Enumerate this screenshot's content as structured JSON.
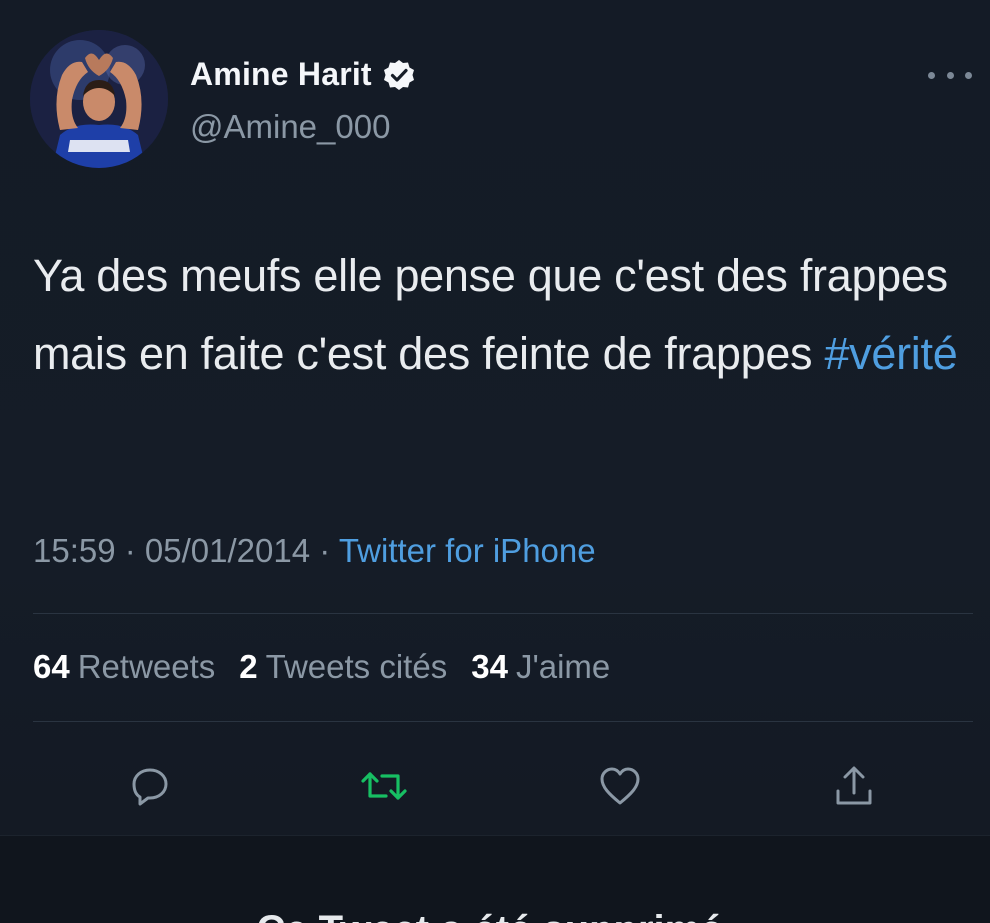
{
  "tweet": {
    "author": {
      "display_name": "Amine Harit",
      "handle": "@Amine_000",
      "verified_icon": "verified-badge-icon",
      "avatar": "profile-photo"
    },
    "text_before_hashtag": "Ya des meufs elle pense que c'est des frappes mais en faite c'est des feinte de frappes ",
    "hashtag": "#vérité",
    "time": "15:59",
    "date": "05/01/2014",
    "separator": " · ",
    "source": "Twitter for iPhone",
    "stats": {
      "retweets_count": "64",
      "retweets_label": "Retweets",
      "quotes_count": "2",
      "quotes_label": "Tweets cités",
      "likes_count": "34",
      "likes_label": "J'aime"
    },
    "actions": [
      "reply-icon",
      "retweet-icon",
      "like-icon",
      "share-icon"
    ]
  },
  "banner": {
    "text": "Ce Tweet a été supprimé."
  },
  "colors": {
    "background": "#151c27",
    "link_blue": "#4f9ee0",
    "retweet_green": "#17bf63",
    "muted_text": "#8b98a5"
  }
}
